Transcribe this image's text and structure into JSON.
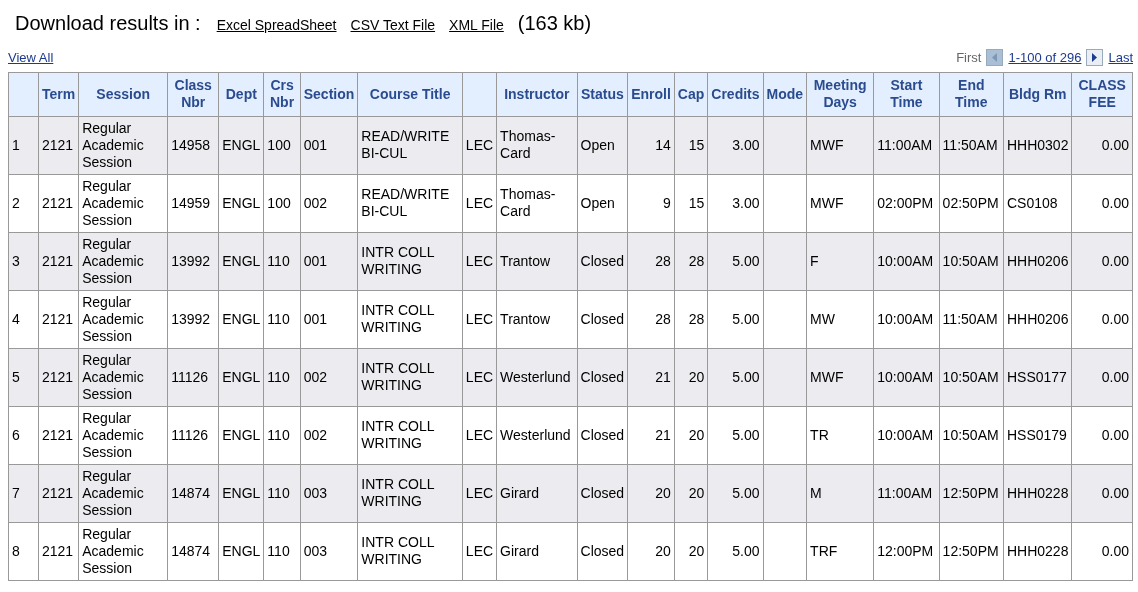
{
  "download": {
    "label": "Download results in :",
    "links": [
      "Excel SpreadSheet",
      "CSV Text File",
      "XML File"
    ],
    "size": "(163 kb)"
  },
  "view_all": "View All",
  "pager": {
    "first": "First",
    "range": "1-100 of 296",
    "last": "Last",
    "prev_disabled": true,
    "next_disabled": false
  },
  "table": {
    "columns": [
      {
        "kind": "text"
      },
      {
        "label": "Term",
        "kind": "text"
      },
      {
        "label": "Session",
        "kind": "text"
      },
      {
        "label": "Class Nbr",
        "kind": "text"
      },
      {
        "label": "Dept",
        "kind": "text"
      },
      {
        "label": "Crs Nbr",
        "kind": "text"
      },
      {
        "label": "Section",
        "kind": "text"
      },
      {
        "label": "Course Title",
        "kind": "text"
      },
      {
        "kind": "text"
      },
      {
        "label": "Instructor",
        "kind": "text"
      },
      {
        "label": "Status",
        "kind": "text"
      },
      {
        "label": "Enroll",
        "kind": "number"
      },
      {
        "label": "Cap",
        "kind": "number"
      },
      {
        "label": "Credits",
        "kind": "number"
      },
      {
        "label": "Mode",
        "kind": "text"
      },
      {
        "label": "Meeting Days",
        "kind": "text"
      },
      {
        "label": "Start Time",
        "kind": "text"
      },
      {
        "label": "End Time",
        "kind": "text"
      },
      {
        "label": "Bldg Rm",
        "kind": "text"
      },
      {
        "label": "CLASS FEE",
        "kind": "number"
      }
    ],
    "rows": [
      [
        "1",
        "2121",
        "Regular Academic Session",
        "14958",
        "ENGL",
        "100",
        "001",
        "READ/WRITE BI-CUL",
        "LEC",
        "Thomas-Card",
        "Open",
        "14",
        "15",
        "3.00",
        null,
        "MWF",
        "11:00AM",
        "11:50AM",
        "HHH0302",
        "0.00"
      ],
      [
        "2",
        "2121",
        "Regular Academic Session",
        "14959",
        "ENGL",
        "100",
        "002",
        "READ/WRITE BI-CUL",
        "LEC",
        "Thomas-Card",
        "Open",
        "9",
        "15",
        "3.00",
        null,
        "MWF",
        "02:00PM",
        "02:50PM",
        "CS0108",
        "0.00"
      ],
      [
        "3",
        "2121",
        "Regular Academic Session",
        "13992",
        "ENGL",
        "110",
        "001",
        "INTR COLL WRITING",
        "LEC",
        "Trantow",
        "Closed",
        "28",
        "28",
        "5.00",
        null,
        "F",
        "10:00AM",
        "10:50AM",
        "HHH0206",
        "0.00"
      ],
      [
        "4",
        "2121",
        "Regular Academic Session",
        "13992",
        "ENGL",
        "110",
        "001",
        "INTR COLL WRITING",
        "LEC",
        "Trantow",
        "Closed",
        "28",
        "28",
        "5.00",
        null,
        "MW",
        "10:00AM",
        "11:50AM",
        "HHH0206",
        "0.00"
      ],
      [
        "5",
        "2121",
        "Regular Academic Session",
        "11126",
        "ENGL",
        "110",
        "002",
        "INTR COLL WRITING",
        "LEC",
        "Westerlund",
        "Closed",
        "21",
        "20",
        "5.00",
        null,
        "MWF",
        "10:00AM",
        "10:50AM",
        "HSS0177",
        "0.00"
      ],
      [
        "6",
        "2121",
        "Regular Academic Session",
        "11126",
        "ENGL",
        "110",
        "002",
        "INTR COLL WRITING",
        "LEC",
        "Westerlund",
        "Closed",
        "21",
        "20",
        "5.00",
        null,
        "TR",
        "10:00AM",
        "10:50AM",
        "HSS0179",
        "0.00"
      ],
      [
        "7",
        "2121",
        "Regular Academic Session",
        "14874",
        "ENGL",
        "110",
        "003",
        "INTR COLL WRITING",
        "LEC",
        "Girard",
        "Closed",
        "20",
        "20",
        "5.00",
        null,
        "M",
        "11:00AM",
        "12:50PM",
        "HHH0228",
        "0.00"
      ],
      [
        "8",
        "2121",
        "Regular Academic Session",
        "14874",
        "ENGL",
        "110",
        "003",
        "INTR COLL WRITING",
        "LEC",
        "Girard",
        "Closed",
        "20",
        "20",
        "5.00",
        null,
        "TRF",
        "12:00PM",
        "12:50PM",
        "HHH0228",
        "0.00"
      ]
    ]
  }
}
